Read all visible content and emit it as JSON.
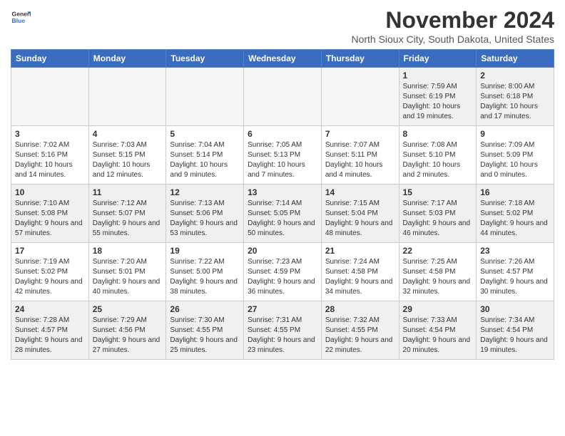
{
  "header": {
    "logo_line1": "General",
    "logo_line2": "Blue",
    "title": "November 2024",
    "subtitle": "North Sioux City, South Dakota, United States"
  },
  "weekdays": [
    "Sunday",
    "Monday",
    "Tuesday",
    "Wednesday",
    "Thursday",
    "Friday",
    "Saturday"
  ],
  "weeks": [
    [
      {
        "day": "",
        "empty": true
      },
      {
        "day": "",
        "empty": true
      },
      {
        "day": "",
        "empty": true
      },
      {
        "day": "",
        "empty": true
      },
      {
        "day": "",
        "empty": true
      },
      {
        "day": "1",
        "rise": "7:59 AM",
        "set": "6:19 PM",
        "daylight": "10 hours and 19 minutes."
      },
      {
        "day": "2",
        "rise": "8:00 AM",
        "set": "6:18 PM",
        "daylight": "10 hours and 17 minutes."
      }
    ],
    [
      {
        "day": "3",
        "rise": "7:02 AM",
        "set": "5:16 PM",
        "daylight": "10 hours and 14 minutes."
      },
      {
        "day": "4",
        "rise": "7:03 AM",
        "set": "5:15 PM",
        "daylight": "10 hours and 12 minutes."
      },
      {
        "day": "5",
        "rise": "7:04 AM",
        "set": "5:14 PM",
        "daylight": "10 hours and 9 minutes."
      },
      {
        "day": "6",
        "rise": "7:05 AM",
        "set": "5:13 PM",
        "daylight": "10 hours and 7 minutes."
      },
      {
        "day": "7",
        "rise": "7:07 AM",
        "set": "5:11 PM",
        "daylight": "10 hours and 4 minutes."
      },
      {
        "day": "8",
        "rise": "7:08 AM",
        "set": "5:10 PM",
        "daylight": "10 hours and 2 minutes."
      },
      {
        "day": "9",
        "rise": "7:09 AM",
        "set": "5:09 PM",
        "daylight": "10 hours and 0 minutes."
      }
    ],
    [
      {
        "day": "10",
        "rise": "7:10 AM",
        "set": "5:08 PM",
        "daylight": "9 hours and 57 minutes."
      },
      {
        "day": "11",
        "rise": "7:12 AM",
        "set": "5:07 PM",
        "daylight": "9 hours and 55 minutes."
      },
      {
        "day": "12",
        "rise": "7:13 AM",
        "set": "5:06 PM",
        "daylight": "9 hours and 53 minutes."
      },
      {
        "day": "13",
        "rise": "7:14 AM",
        "set": "5:05 PM",
        "daylight": "9 hours and 50 minutes."
      },
      {
        "day": "14",
        "rise": "7:15 AM",
        "set": "5:04 PM",
        "daylight": "9 hours and 48 minutes."
      },
      {
        "day": "15",
        "rise": "7:17 AM",
        "set": "5:03 PM",
        "daylight": "9 hours and 46 minutes."
      },
      {
        "day": "16",
        "rise": "7:18 AM",
        "set": "5:02 PM",
        "daylight": "9 hours and 44 minutes."
      }
    ],
    [
      {
        "day": "17",
        "rise": "7:19 AM",
        "set": "5:02 PM",
        "daylight": "9 hours and 42 minutes."
      },
      {
        "day": "18",
        "rise": "7:20 AM",
        "set": "5:01 PM",
        "daylight": "9 hours and 40 minutes."
      },
      {
        "day": "19",
        "rise": "7:22 AM",
        "set": "5:00 PM",
        "daylight": "9 hours and 38 minutes."
      },
      {
        "day": "20",
        "rise": "7:23 AM",
        "set": "4:59 PM",
        "daylight": "9 hours and 36 minutes."
      },
      {
        "day": "21",
        "rise": "7:24 AM",
        "set": "4:58 PM",
        "daylight": "9 hours and 34 minutes."
      },
      {
        "day": "22",
        "rise": "7:25 AM",
        "set": "4:58 PM",
        "daylight": "9 hours and 32 minutes."
      },
      {
        "day": "23",
        "rise": "7:26 AM",
        "set": "4:57 PM",
        "daylight": "9 hours and 30 minutes."
      }
    ],
    [
      {
        "day": "24",
        "rise": "7:28 AM",
        "set": "4:57 PM",
        "daylight": "9 hours and 28 minutes."
      },
      {
        "day": "25",
        "rise": "7:29 AM",
        "set": "4:56 PM",
        "daylight": "9 hours and 27 minutes."
      },
      {
        "day": "26",
        "rise": "7:30 AM",
        "set": "4:55 PM",
        "daylight": "9 hours and 25 minutes."
      },
      {
        "day": "27",
        "rise": "7:31 AM",
        "set": "4:55 PM",
        "daylight": "9 hours and 23 minutes."
      },
      {
        "day": "28",
        "rise": "7:32 AM",
        "set": "4:55 PM",
        "daylight": "9 hours and 22 minutes."
      },
      {
        "day": "29",
        "rise": "7:33 AM",
        "set": "4:54 PM",
        "daylight": "9 hours and 20 minutes."
      },
      {
        "day": "30",
        "rise": "7:34 AM",
        "set": "4:54 PM",
        "daylight": "9 hours and 19 minutes."
      }
    ]
  ]
}
